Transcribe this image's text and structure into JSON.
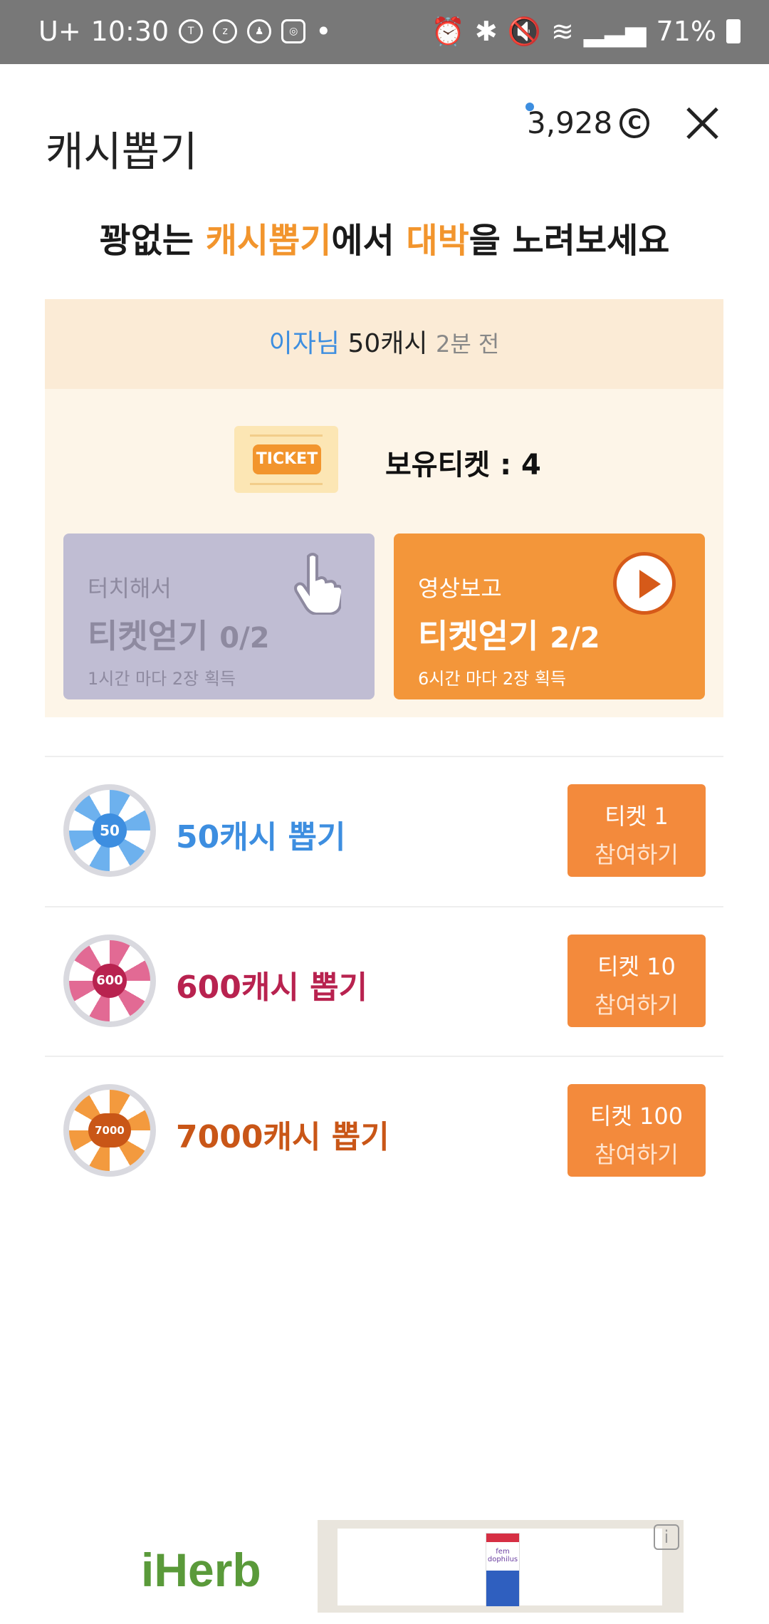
{
  "status_bar": {
    "carrier": "U+",
    "time": "10:30",
    "battery": "71%",
    "icons": [
      "kakaotalk-icon",
      "zeta-icon",
      "notification-icon",
      "instagram-icon",
      "alarm-icon",
      "bluetooth-icon",
      "mute-icon",
      "wifi-icon",
      "signal-icon",
      "battery-icon"
    ]
  },
  "header": {
    "title": "캐시뽑기",
    "coin_balance": "3,928",
    "coin_icon": "Ⓒ",
    "close_icon": "close-icon"
  },
  "headline": {
    "part1": "꽝없는 ",
    "part2": "캐시뽑기",
    "part3": "에서 ",
    "part4": "대박",
    "part5": "을 노려보세요"
  },
  "ticker": {
    "user": "이자님",
    "amount": "50캐시",
    "time": "2분 전"
  },
  "tickets": {
    "label": "TICKET",
    "owned": "보유티켓 : 4"
  },
  "cards": {
    "touch": {
      "sub": "터치해서",
      "main": "티켓얻기",
      "count": "0/2",
      "note": "1시간 마다 2장 획득"
    },
    "video": {
      "sub": "영상보고",
      "main": "티켓얻기",
      "count": "2/2",
      "note": "6시간 마다 2장 획득"
    }
  },
  "draws": [
    {
      "wheel_label": "50",
      "label": "50캐시 뽑기",
      "ticket": "티켓 1",
      "action": "참여하기",
      "color": "#3d8ee0"
    },
    {
      "wheel_label": "600",
      "label": "600캐시 뽑기",
      "ticket": "티켓 10",
      "action": "참여하기",
      "color": "#b8224f"
    },
    {
      "wheel_label": "7000",
      "label": "7000캐시 뽑기",
      "ticket": "티켓 100",
      "action": "참여하기",
      "color": "#c95617"
    }
  ],
  "ad": {
    "logo": "iHerb",
    "product_brand": "fem dophilus",
    "info_icon": "i"
  }
}
